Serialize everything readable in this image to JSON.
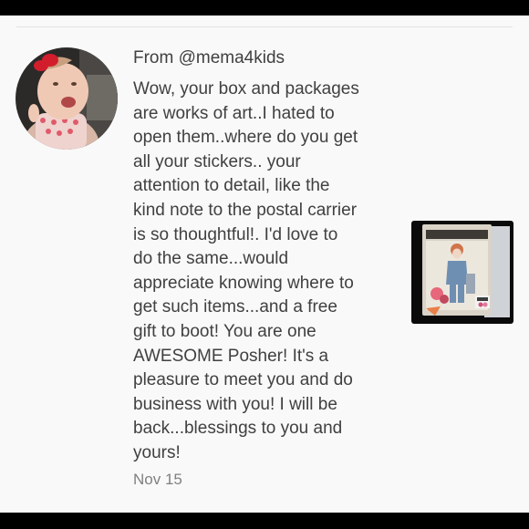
{
  "review": {
    "from": "From @mema4kids",
    "message_lines": [
      "Wow, your box and packages",
      "are works of art..I hated to",
      "open them..where do you get",
      "all your stickers.. your",
      "attention to detail, like the",
      "kind note to the postal carrier",
      "is so thoughtful!. I'd love to",
      "do the same...would",
      "appreciate knowing where to",
      "get such items...and a free",
      "gift to boot! You are one",
      "AWESOME Posher! It's a",
      "pleasure to meet you and do",
      "business with you! I will be",
      "back...blessings to you and",
      "yours!"
    ],
    "date": "Nov 15",
    "avatar_icon": "user-avatar-photo",
    "thumbnail_icon": "listing-photo-doll-box"
  },
  "colors": {
    "frame": "#000000",
    "background": "#f9f9f9",
    "text": "#404040",
    "muted_text": "#808080",
    "divider": "#e2e2e2"
  }
}
